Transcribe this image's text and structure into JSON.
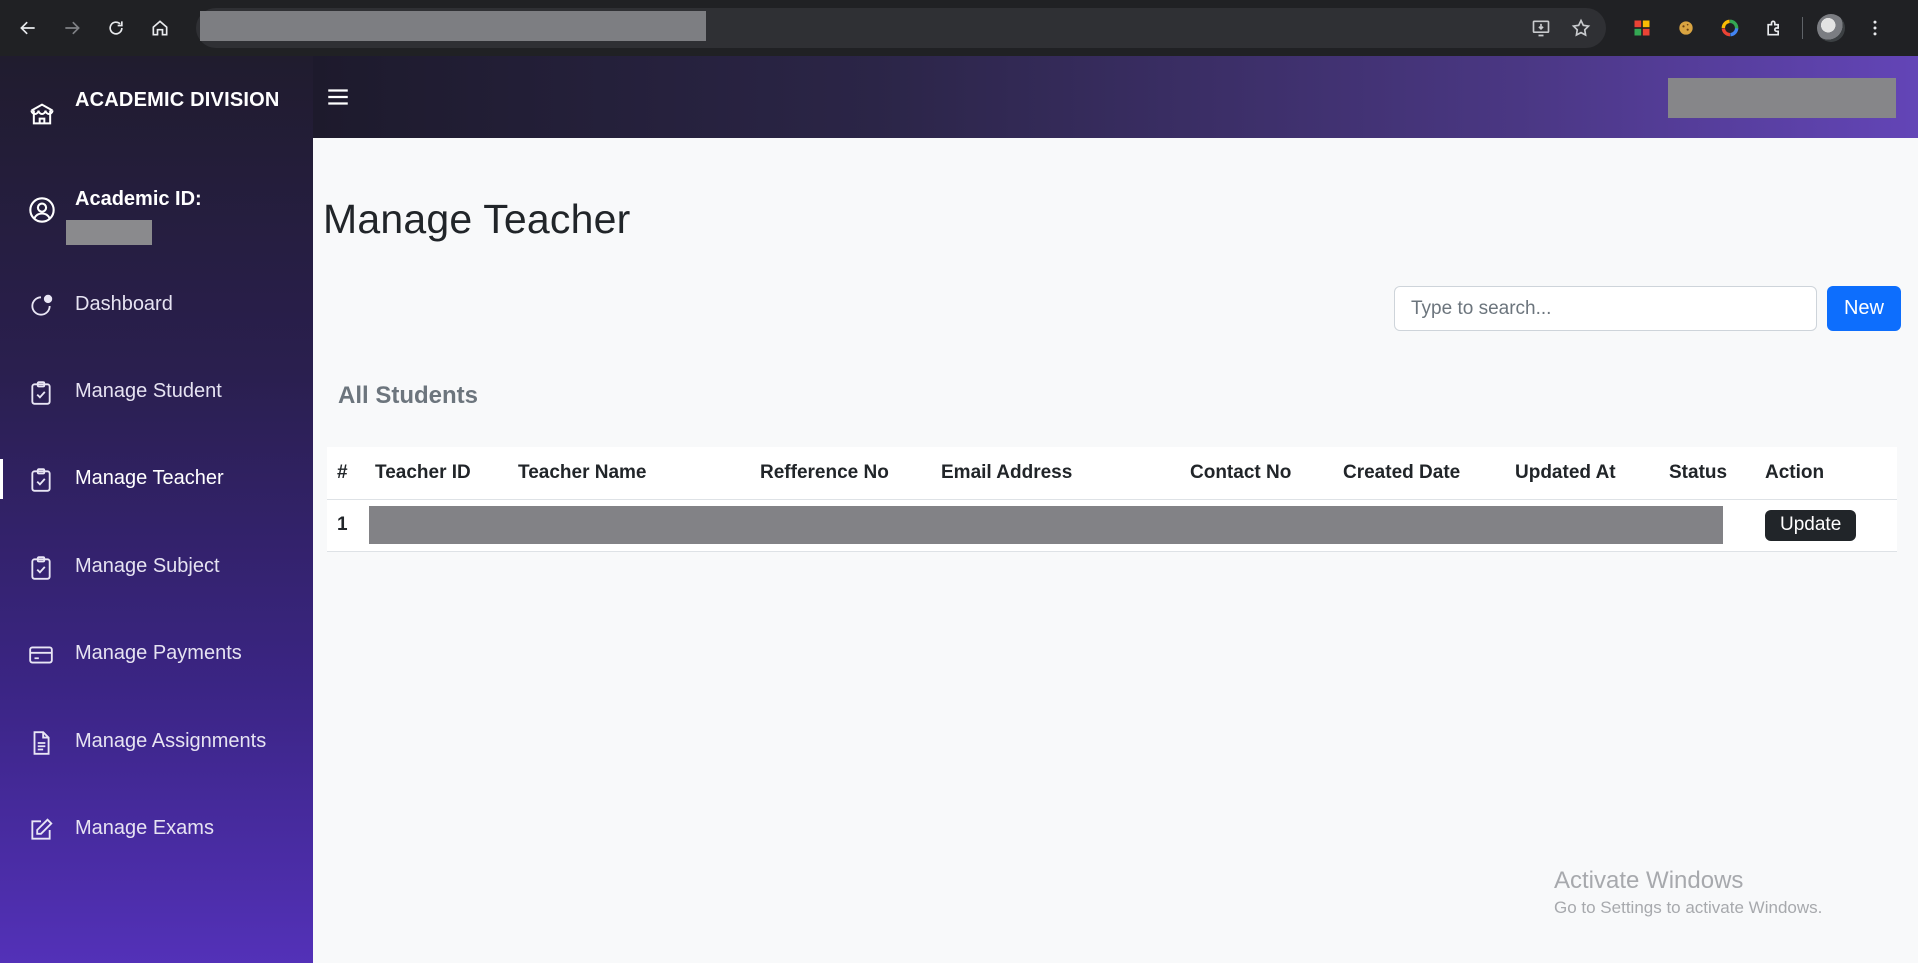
{
  "browser": {
    "icons": {
      "back": "back-arrow-icon",
      "forward": "forward-arrow-icon",
      "reload": "reload-icon",
      "home": "home-icon",
      "install": "install-app-icon",
      "bookmark": "star-icon",
      "extensions": "puzzle-icon",
      "menu": "kebab-menu-icon"
    }
  },
  "sidebar": {
    "brand": "ACADEMIC DIVISION",
    "academic_label": "Academic ID:",
    "items": [
      {
        "label": "Dashboard",
        "icon": "dashboard-icon"
      },
      {
        "label": "Manage Student",
        "icon": "clipboard-check-icon"
      },
      {
        "label": "Manage Teacher",
        "icon": "clipboard-check-icon",
        "active": true
      },
      {
        "label": "Manage Subject",
        "icon": "clipboard-check-icon"
      },
      {
        "label": "Manage Payments",
        "icon": "credit-card-icon"
      },
      {
        "label": "Manage Assignments",
        "icon": "document-icon"
      },
      {
        "label": "Manage Exams",
        "icon": "edit-icon"
      }
    ]
  },
  "page": {
    "title": "Manage Teacher",
    "search_placeholder": "Type to search...",
    "new_label": "New",
    "section_title": "All Students"
  },
  "table": {
    "columns": [
      "#",
      "Teacher ID",
      "Teacher Name",
      "Refference No",
      "Email Address",
      "Contact No",
      "Created Date",
      "Updated At",
      "Status",
      "Action"
    ],
    "rows": [
      {
        "index": "1",
        "action": "Update"
      }
    ]
  },
  "watermark": {
    "line1": "Activate Windows",
    "line2": "Go to Settings to activate Windows."
  },
  "colors": {
    "primary": "#0d6efd",
    "dark_button": "#212529",
    "sidebar_top": "#201c2e",
    "sidebar_bottom": "#5331b8"
  }
}
